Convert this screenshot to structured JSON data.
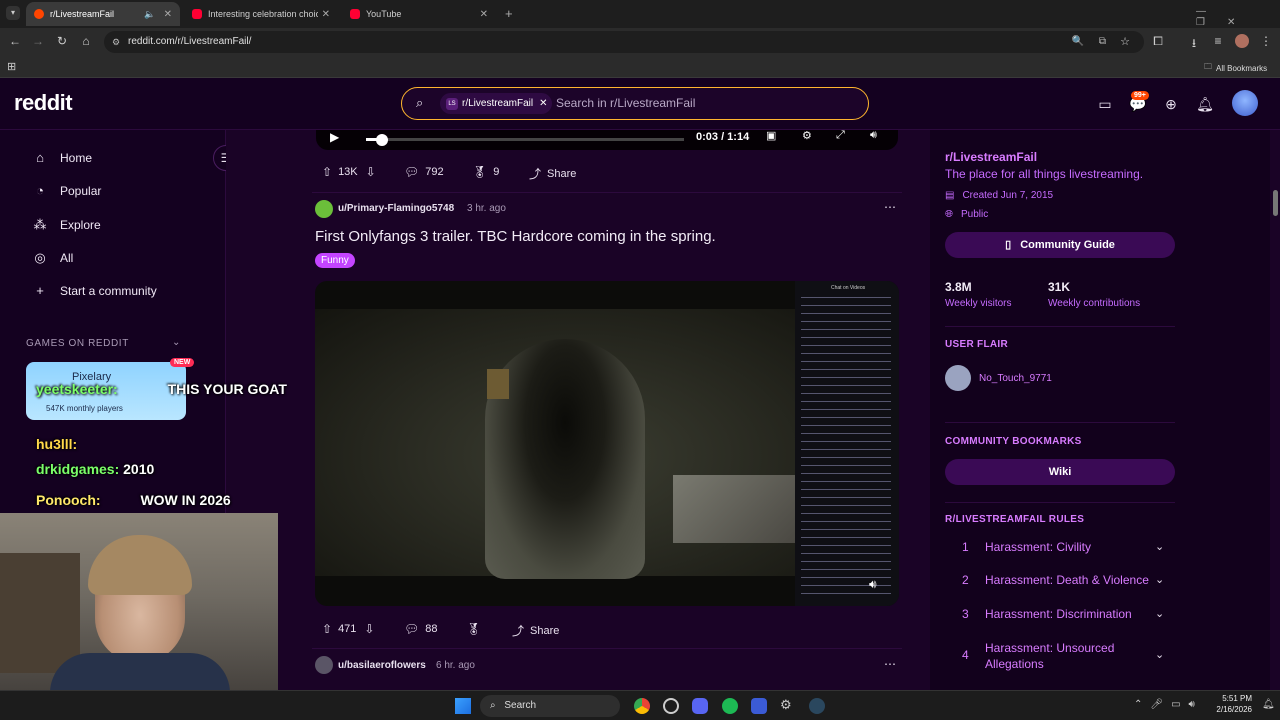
{
  "browser": {
    "tabs": [
      {
        "title": "r/LivestreamFail",
        "active": true
      },
      {
        "title": "Interesting celebration choice b",
        "active": false
      },
      {
        "title": "YouTube",
        "active": false
      }
    ],
    "url": "reddit.com/r/LivestreamFail/",
    "bookmarks_label": "All Bookmarks"
  },
  "header": {
    "logo": "reddit",
    "search_chip": "r/LivestreamFail",
    "search_placeholder": "Search in r/LivestreamFail",
    "notification_badge": "99+"
  },
  "leftnav": {
    "items": [
      {
        "label": "Home",
        "icon": "home-icon"
      },
      {
        "label": "Popular",
        "icon": "popular-icon"
      },
      {
        "label": "Explore",
        "icon": "explore-icon"
      },
      {
        "label": "All",
        "icon": "all-icon"
      },
      {
        "label": "Start a community",
        "icon": "plus-icon"
      }
    ],
    "games_heading": "GAMES ON REDDIT",
    "game": {
      "name": "Pixelary",
      "badge": "NEW",
      "users": "547K monthly players"
    }
  },
  "feed": {
    "video_top": {
      "time": "0:03 / 1:14"
    },
    "post1_actions": {
      "upvotes": "13K",
      "comments": "792",
      "awards": "9",
      "share": "Share"
    },
    "post2": {
      "user": "u/Primary-Flamingo5748",
      "time": "3 hr. ago",
      "title": "First Onlyfangs 3 trailer. TBC Hardcore coming in the spring.",
      "flair": "Funny",
      "chat_header": "Chat on Videos",
      "actions": {
        "upvotes": "471",
        "comments": "88",
        "share": "Share"
      }
    },
    "post3": {
      "user": "u/basilaeroflowers",
      "time": "6 hr. ago"
    }
  },
  "sidebar": {
    "name": "r/LivestreamFail",
    "description": "The place for all things livestreaming.",
    "created": "Created Jun 7, 2015",
    "visibility": "Public",
    "guide_button": "Community Guide",
    "stats": [
      {
        "value": "3.8M",
        "label": "Weekly visitors"
      },
      {
        "value": "31K",
        "label": "Weekly contributions"
      }
    ],
    "user_flair_heading": "USER FLAIR",
    "user_flair": "No_Touch_9771",
    "bookmarks_heading": "COMMUNITY BOOKMARKS",
    "wiki": "Wiki",
    "rules_heading": "R/LIVESTREAMFAIL RULES",
    "rules": [
      {
        "num": "1",
        "text": "Harassment: Civility"
      },
      {
        "num": "2",
        "text": "Harassment: Death & Violence"
      },
      {
        "num": "3",
        "text": "Harassment: Discrimination"
      },
      {
        "num": "4",
        "text": "Harassment: Unsourced Allegations"
      }
    ]
  },
  "overlay_chat": [
    {
      "user": "yeetskeeter:",
      "msg": "THIS YOUR GOAT"
    },
    {
      "user": "hu3lll:",
      "msg": ""
    },
    {
      "user": "drkidgames:",
      "msg": "2010"
    },
    {
      "user": "Ponooch:",
      "msg": "WOW IN 2026"
    }
  ],
  "taskbar": {
    "search": "Search",
    "time": "5:51 PM",
    "date": "2/16/2026"
  }
}
